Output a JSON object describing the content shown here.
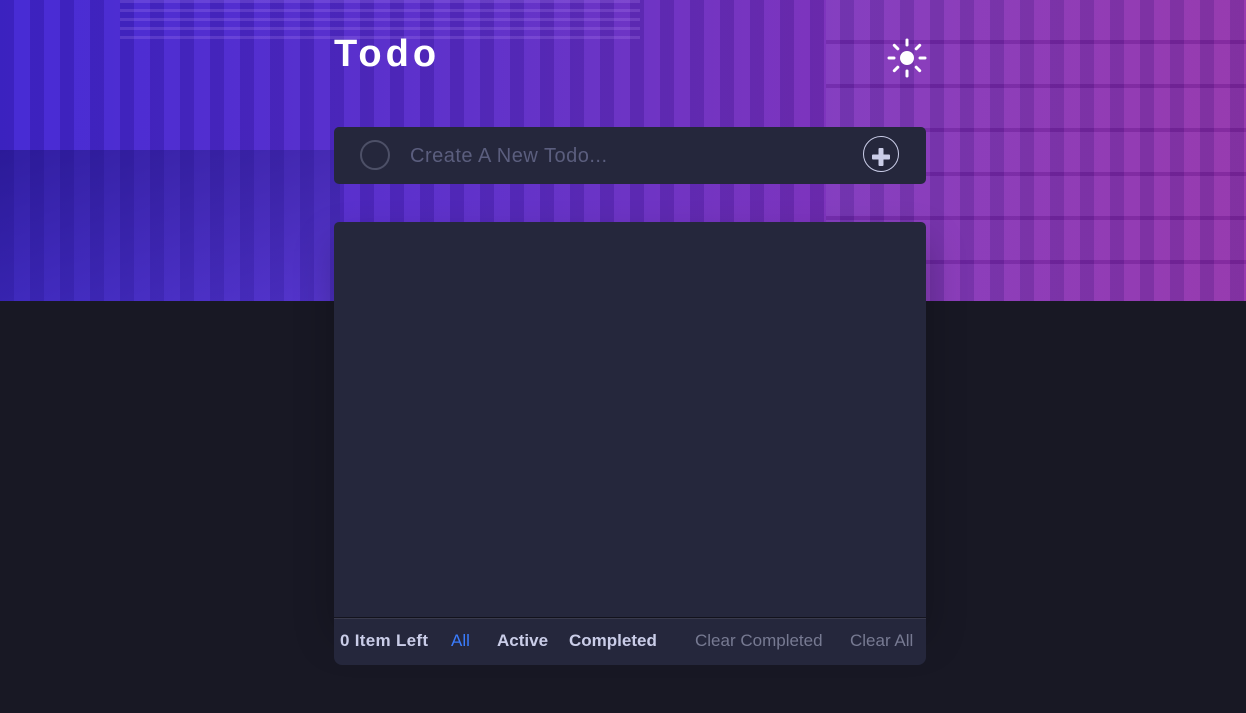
{
  "header": {
    "title": "Todo",
    "theme_toggle_icon": "sun-icon"
  },
  "new_todo": {
    "placeholder": "Create A New Todo...",
    "value": "",
    "add_icon": "plus-icon"
  },
  "todo_list": {
    "items": []
  },
  "footer": {
    "items_left": "0 Item Left",
    "filters": [
      {
        "label": "All",
        "active": true
      },
      {
        "label": "Active",
        "active": false
      },
      {
        "label": "Completed",
        "active": false
      }
    ],
    "clear_completed": "Clear Completed",
    "clear_all": "Clear All"
  },
  "colors": {
    "accent": "#3a7cfd",
    "card": "#25273c",
    "page_background": "#181824",
    "hero_gradient_start": "#3b25c9",
    "hero_gradient_end": "#8a2fa8"
  }
}
